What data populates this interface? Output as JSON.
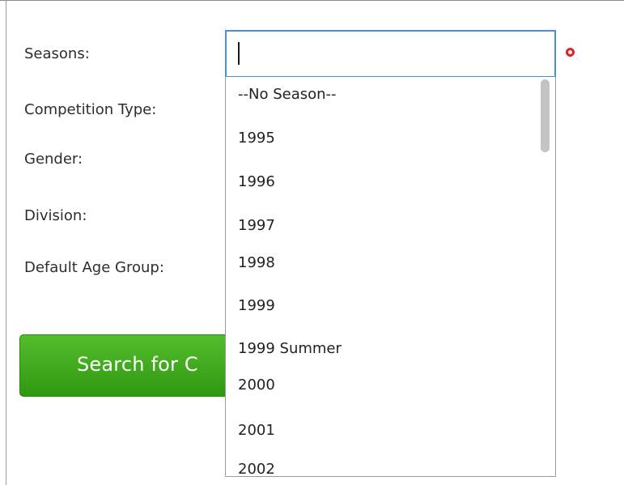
{
  "form": {
    "labels": {
      "seasons": "Seasons:",
      "competition_type": "Competition Type:",
      "gender": "Gender:",
      "division": "Division:",
      "default_age_group": "Default Age Group:"
    },
    "search_button_label": "Search for C",
    "required_marker_color": "#e0212b"
  },
  "seasons_select": {
    "value": "",
    "focus_color": "#4a90d9",
    "options": [
      "--No Season--",
      "1995",
      "1996",
      "1997",
      "1998",
      "1999",
      "1999 Summer",
      "2000",
      "2001",
      "2002"
    ]
  },
  "colors": {
    "button_green": "#3aa61a",
    "text": "#2d2d2d"
  }
}
